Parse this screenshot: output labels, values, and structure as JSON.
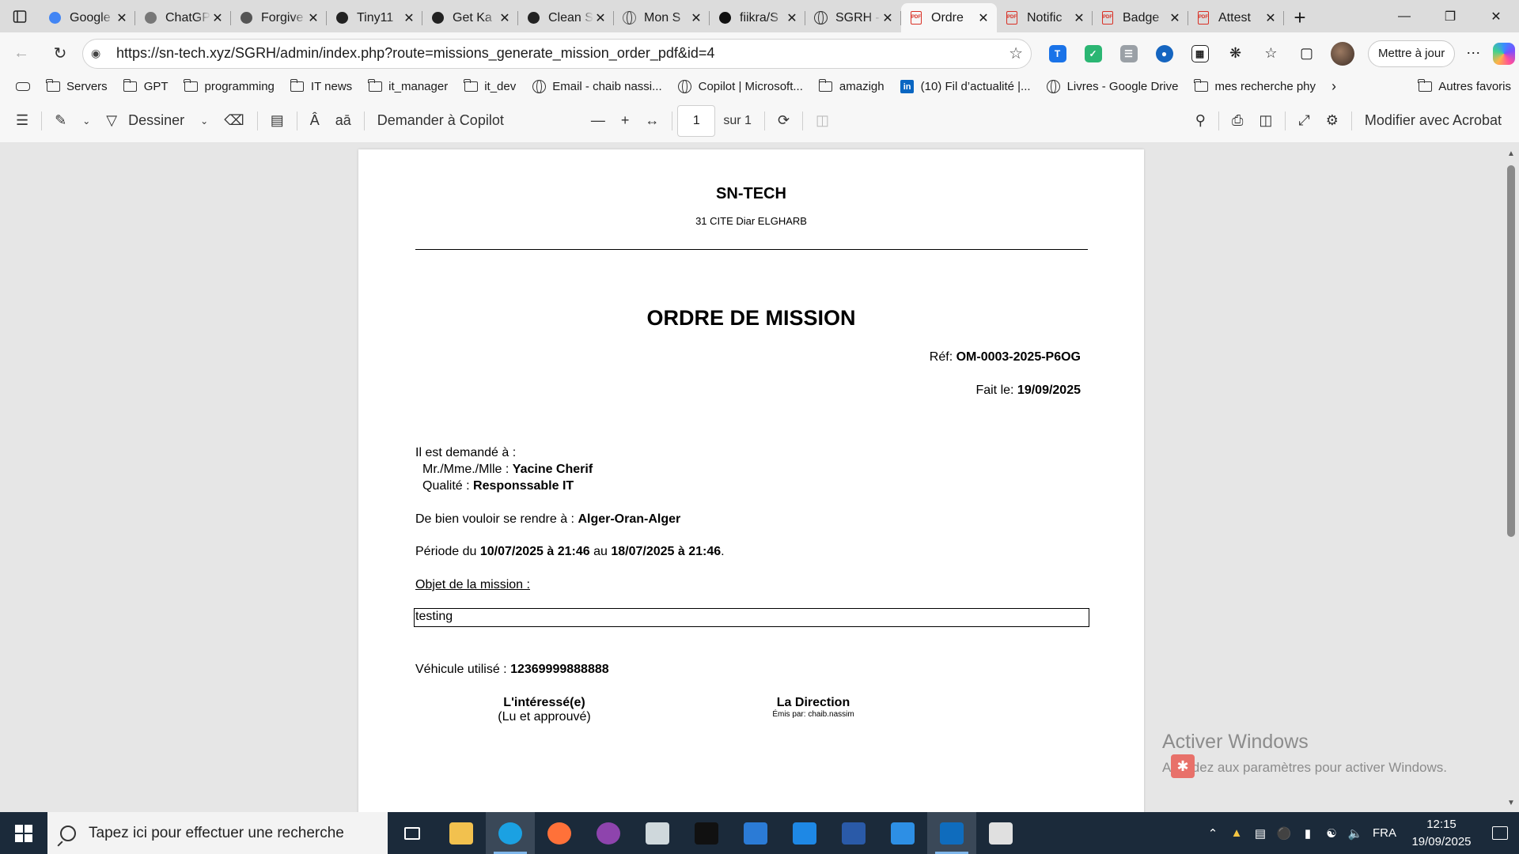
{
  "browser": {
    "tabs": [
      {
        "title": "Google Gemini",
        "icon": "gemini-icon",
        "color": "#4285f4"
      },
      {
        "title": "ChatGPT",
        "icon": "chatgpt-icon",
        "color": "#777777"
      },
      {
        "title": "Forgive",
        "icon": "drive-icon",
        "color": "#555555"
      },
      {
        "title": "Tiny11",
        "icon": "archive-icon",
        "color": "#222222"
      },
      {
        "title": "Get Ka",
        "icon": "cursor-icon",
        "color": "#222222"
      },
      {
        "title": "Clean S",
        "icon": "openai-icon",
        "color": "#222222"
      },
      {
        "title": "Mon S",
        "icon": "globe-icon",
        "color": "#666666"
      },
      {
        "title": "fiikra/S",
        "icon": "github-icon",
        "color": "#111111"
      },
      {
        "title": "SGRH -",
        "icon": "globe-icon",
        "color": "#333333"
      },
      {
        "title": "Ordre",
        "icon": "pdf-icon",
        "color": "#d93025",
        "active": true
      },
      {
        "title": "Notific",
        "icon": "pdf-icon",
        "color": "#d93025"
      },
      {
        "title": "Badge",
        "icon": "pdf-icon",
        "color": "#d93025"
      },
      {
        "title": "Attest",
        "icon": "pdf-icon",
        "color": "#d93025"
      }
    ],
    "url": "https://sn-tech.xyz/SGRH/admin/index.php?route=missions_generate_mission_order_pdf&id=4",
    "update_label": "Mettre à jour",
    "favorites": [
      {
        "label": "Servers",
        "icon": "folder-icon"
      },
      {
        "label": "GPT",
        "icon": "folder-icon"
      },
      {
        "label": "programming",
        "icon": "folder-icon"
      },
      {
        "label": "IT news",
        "icon": "folder-icon"
      },
      {
        "label": "it_manager",
        "icon": "folder-icon"
      },
      {
        "label": "it_dev",
        "icon": "folder-icon"
      },
      {
        "label": "Email - chaib nassi...",
        "icon": "globe-icon"
      },
      {
        "label": "Copilot | Microsoft...",
        "icon": "globe-icon"
      },
      {
        "label": "amazigh",
        "icon": "folder-icon"
      },
      {
        "label": "(10) Fil d’actualité |...",
        "icon": "linkedin-icon"
      },
      {
        "label": "Livres - Google Drive",
        "icon": "globe-icon"
      },
      {
        "label": "mes recherche phy",
        "icon": "folder-icon"
      }
    ],
    "other_favorites": "Autres favoris"
  },
  "pdf_toolbar": {
    "draw_label": "Dessiner",
    "copilot_label": "Demander à Copilot",
    "page_current": "1",
    "page_total": "sur 1",
    "acrobat_label": "Modifier avec Acrobat"
  },
  "document": {
    "company": "SN-TECH",
    "address": "31 CITE Diar ELGHARB",
    "title": "ORDRE DE MISSION",
    "ref_label": "Réf: ",
    "ref_value": "OM-0003-2025-P6OG",
    "date_label": "Fait le: ",
    "date_value": "19/09/2025",
    "requested_label": "Il est demandé à :",
    "person_label": "Mr./Mme./Mlle : ",
    "person_value": "Yacine Cherif",
    "quality_label": "Qualité : ",
    "quality_value": "Responssable IT",
    "destination_label": "De bien vouloir se rendre à : ",
    "destination_value": "Alger-Oran-Alger",
    "period_label": "Période du ",
    "period_from": "10/07/2025 à 21:46",
    "period_to_label": " au ",
    "period_to": "18/07/2025 à 21:46",
    "period_end": ".",
    "object_label": "Objet de la mission :",
    "object_value": "testing",
    "vehicle_label": "Véhicule utilisé : ",
    "vehicle_value": "12369999888888",
    "sig_left_title": "L'intéressé(e)",
    "sig_left_sub": "(Lu et approuvé)",
    "sig_right_title": "La Direction",
    "sig_right_sub": "Émis par: chaib.nassim"
  },
  "watermark": {
    "line1": "Activer Windows",
    "line2": "Accédez aux paramètres pour activer Windows."
  },
  "taskbar": {
    "search_placeholder": "Tapez ici pour effectuer une recherche",
    "apps": [
      {
        "name": "task-view",
        "color": "#1b2a3a"
      },
      {
        "name": "file-explorer",
        "color": "#f2c14e"
      },
      {
        "name": "edge",
        "color": "#1ba1e2",
        "active": true
      },
      {
        "name": "firefox",
        "color": "#ff7139"
      },
      {
        "name": "github-desktop",
        "color": "#8e44ad"
      },
      {
        "name": "app-generic",
        "color": "#cfd8dc"
      },
      {
        "name": "terminal",
        "color": "#111111"
      },
      {
        "name": "remote-desktop",
        "color": "#2b7bd6"
      },
      {
        "name": "sync-app",
        "color": "#1e88e5"
      },
      {
        "name": "powershell",
        "color": "#2a5aa8"
      },
      {
        "name": "vscode",
        "color": "#2d8fe5"
      },
      {
        "name": "outlook",
        "color": "#0f6cbd",
        "active": true
      },
      {
        "name": "paint-app",
        "color": "#e0e0e0"
      }
    ],
    "language": "FRA",
    "time": "12:15",
    "date": "19/09/2025"
  }
}
